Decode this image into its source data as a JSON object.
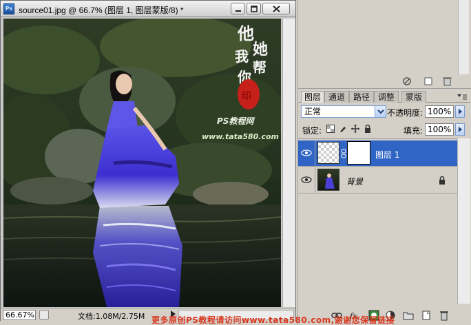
{
  "window": {
    "title": "source01.jpg @ 66.7% (图层 1, 图层蒙版/8) *",
    "zoom": "66.67%",
    "doc_info": "文档:1.08M/2.75M"
  },
  "canvas": {
    "watermark_text": "PS教程网",
    "watermark_url": "www.tata580.com",
    "calligraphy": "他她我帮你",
    "bottom_banner": "更多原创PS教程请访问www.tata580.com,谢谢您保留链接"
  },
  "layers_panel": {
    "tabs": [
      "图层",
      "通道",
      "路径",
      "调整",
      "蒙版"
    ],
    "active_tab": 0,
    "blend_mode": "正常",
    "opacity_label": "不透明度:",
    "opacity": "100%",
    "lock_label": "锁定:",
    "fill_label": "填充:",
    "fill": "100%",
    "layers": [
      {
        "name": "图层 1",
        "selected": true,
        "has_mask": true
      },
      {
        "name": "背景",
        "selected": false,
        "locked": true
      }
    ]
  },
  "colors": {
    "selection": "#3165c5",
    "watermark_red": "#d93820",
    "watermark_green": "#1d6b1d"
  }
}
